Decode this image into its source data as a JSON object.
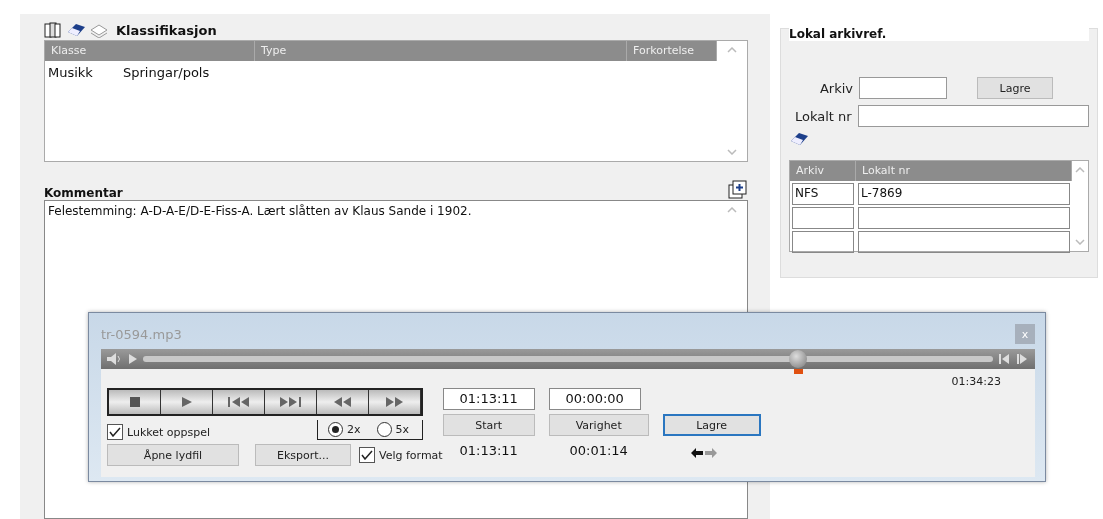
{
  "classification": {
    "title": "Klassifikasjon",
    "columns": [
      "Klasse",
      "Type",
      "Forkortelse"
    ],
    "rows": [
      [
        "Musikk",
        "Springar/pols",
        ""
      ]
    ]
  },
  "comment": {
    "label": "Kommentar",
    "value": "Felestemming: A-D-A-E/D-E-Fiss-A. Lært slåtten av Klaus Sande i 1902."
  },
  "archive": {
    "title": "Lokal arkivref.",
    "arkiv_label": "Arkiv",
    "save": "Lagre",
    "nr_label": "Lokalt nr",
    "columns": [
      "Arkiv",
      "Lokalt nr"
    ],
    "rows": [
      [
        "NFS",
        "L-7869"
      ],
      [
        "",
        ""
      ],
      [
        "",
        ""
      ]
    ]
  },
  "player": {
    "title": "tr-0594.mp3",
    "close": "x",
    "level": 0.77,
    "total": "01:34:23",
    "controls": [
      {
        "kind": "stop"
      },
      {
        "kind": "play"
      },
      {
        "kind": "prev"
      },
      {
        "kind": "next"
      },
      {
        "kind": "rewind"
      },
      {
        "kind": "forward"
      }
    ],
    "closed_playback": {
      "label": "Lukket oppspel",
      "checked": true
    },
    "speeds": [
      {
        "label": "2x",
        "selected": true
      },
      {
        "label": "5x",
        "selected": false
      }
    ],
    "open_file": "Åpne lydfil",
    "export": "Eksport...",
    "choose_format": {
      "label": "Velg format",
      "checked": true
    },
    "start_value": "01:13:11",
    "start_button": "Start",
    "start_time": "01:13:11",
    "duration_value": "00:00:00",
    "duration_button": "Varighet",
    "duration_time": "00:01:14",
    "save": "Lagre"
  }
}
